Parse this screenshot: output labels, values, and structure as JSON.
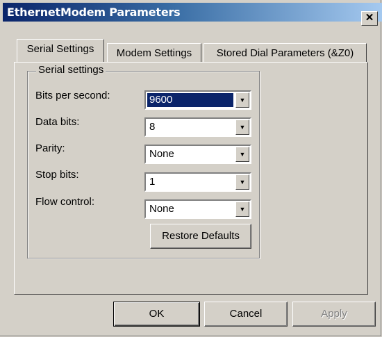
{
  "window": {
    "title": "EthernetModem Parameters",
    "close_glyph": "✕",
    "close_icon": "close-icon"
  },
  "tabs": [
    {
      "label": "Serial Settings",
      "active": true
    },
    {
      "label": "Modem Settings",
      "active": false
    },
    {
      "label": "Stored Dial Parameters (&Z0)",
      "active": false
    }
  ],
  "serial": {
    "group_label": "Serial settings",
    "fields": [
      {
        "label": "Bits per second:",
        "value": "9600"
      },
      {
        "label": "Data bits:",
        "value": "8"
      },
      {
        "label": "Parity:",
        "value": "None"
      },
      {
        "label": "Stop bits:",
        "value": "1"
      },
      {
        "label": "Flow control:",
        "value": "None"
      }
    ],
    "dropdown_glyph": "▼",
    "dropdown_icon": "chevron-down-icon",
    "restore_label": "Restore Defaults"
  },
  "footer": {
    "ok_label": "OK",
    "cancel_label": "Cancel",
    "apply_label": "Apply"
  },
  "colors": {
    "title_start": "#0a246a",
    "title_end": "#a6caf0",
    "face": "#d4d0c8",
    "selection": "#0a246a"
  }
}
